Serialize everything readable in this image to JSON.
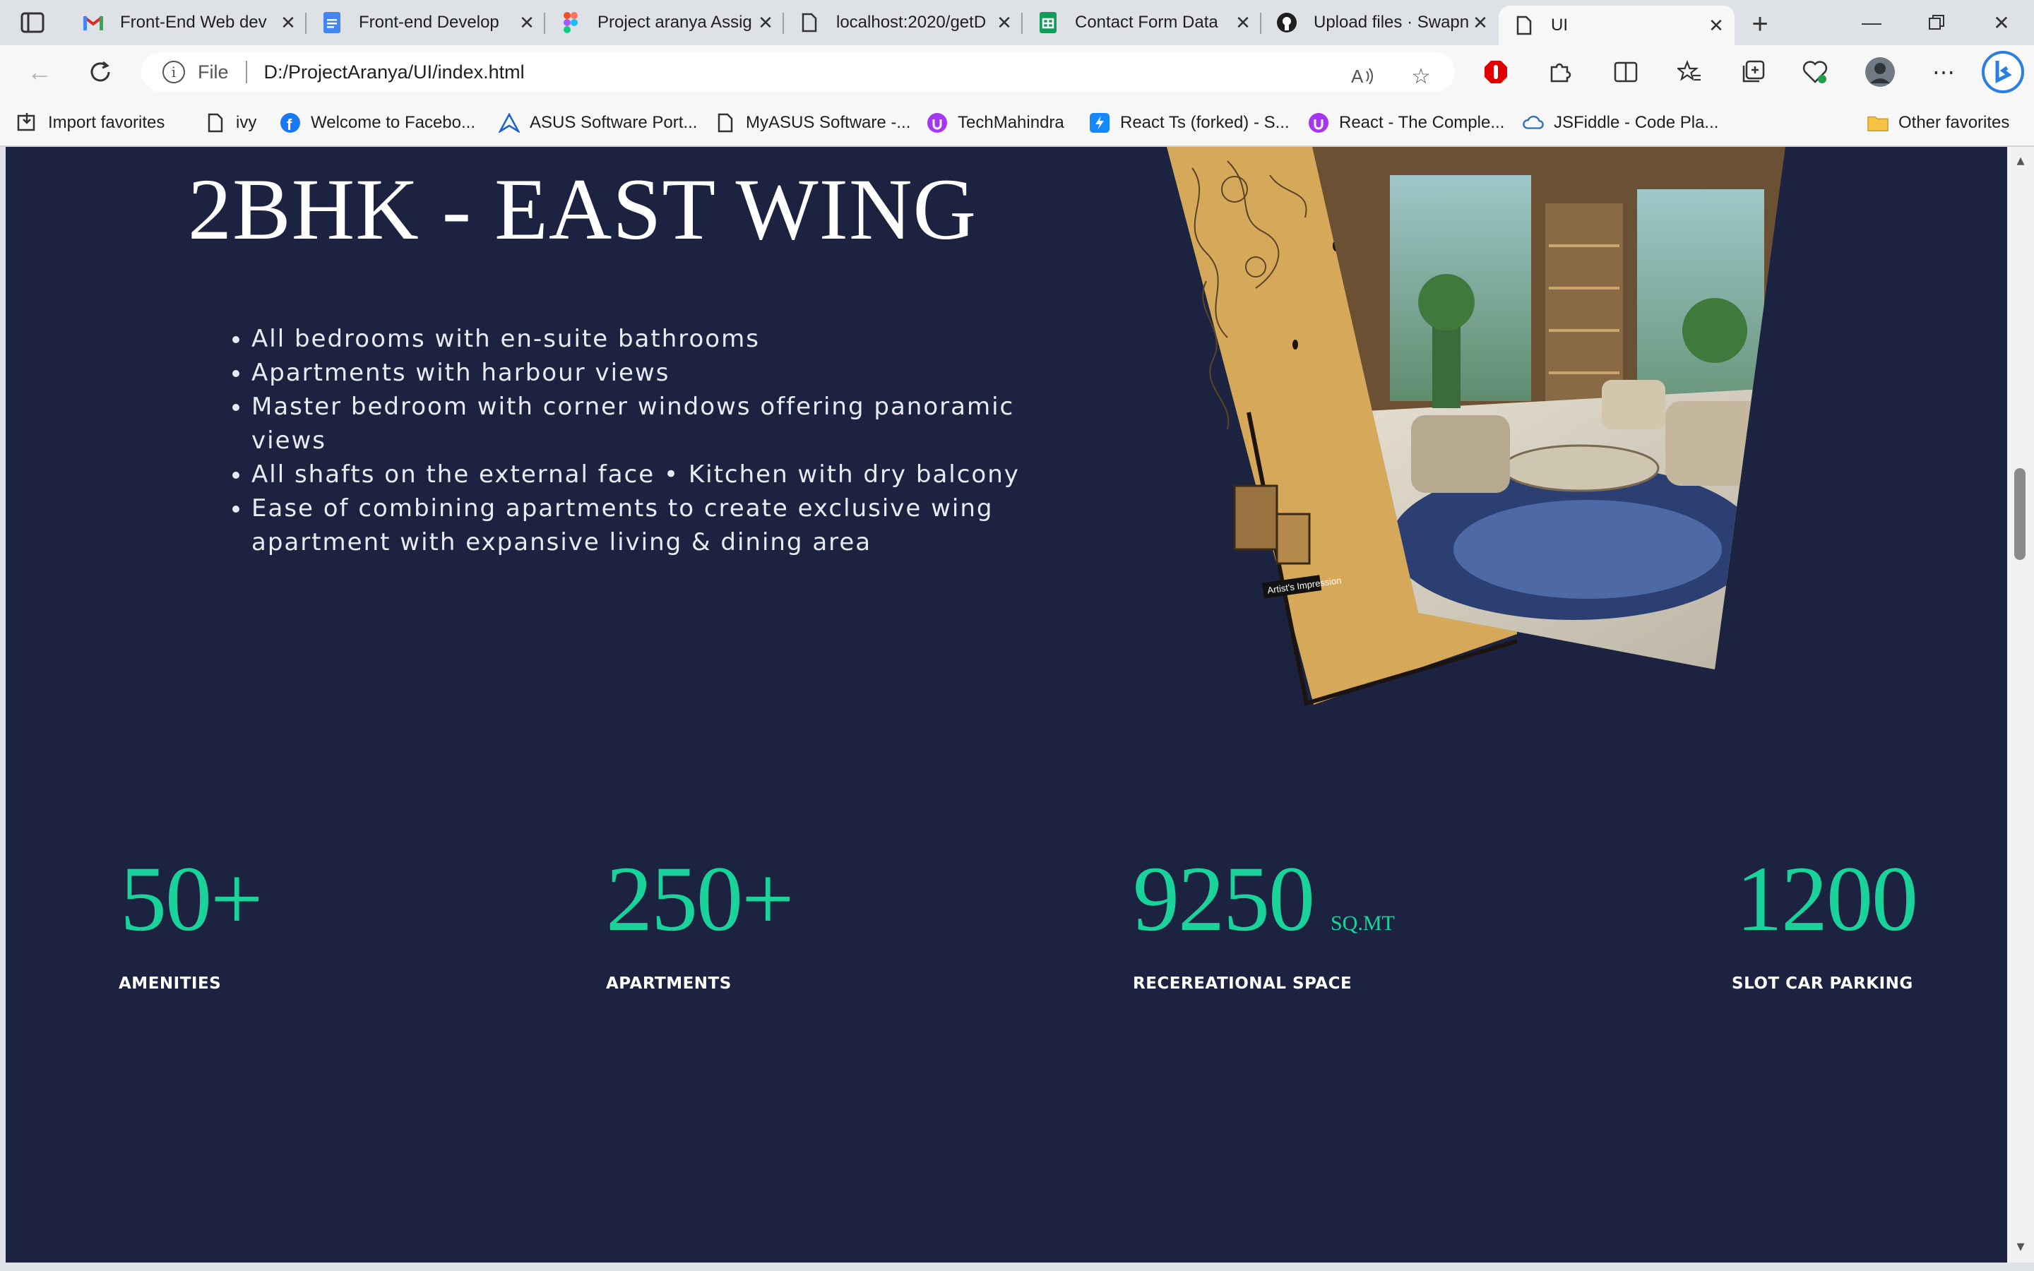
{
  "browser": {
    "tabs": [
      {
        "title": "Front-End Web dev",
        "icon": "gmail-icon"
      },
      {
        "title": "Front-end Develop",
        "icon": "google-docs-icon"
      },
      {
        "title": "Project aranya Assig",
        "icon": "figma-icon"
      },
      {
        "title": "localhost:2020/getD",
        "icon": "page-icon"
      },
      {
        "title": "Contact Form Data",
        "icon": "google-sheets-icon"
      },
      {
        "title": "Upload files · Swapn",
        "icon": "github-icon"
      },
      {
        "title": "UI",
        "icon": "page-icon",
        "active": true
      }
    ],
    "address": {
      "scheme_label": "File",
      "url": "D:/ProjectAranya/UI/index.html"
    },
    "favorites": [
      {
        "label": "Import favorites"
      },
      {
        "label": "ivy"
      },
      {
        "label": "Welcome to Facebo..."
      },
      {
        "label": "ASUS Software Port..."
      },
      {
        "label": "MyASUS Software -..."
      },
      {
        "label": "TechMahindra"
      },
      {
        "label": "React Ts (forked) - S..."
      },
      {
        "label": "React - The Comple..."
      },
      {
        "label": "JSFiddle - Code Pla..."
      }
    ],
    "other_favorites": "Other favorites"
  },
  "page": {
    "heading": "2BHK - EAST WING",
    "features": [
      "All bedrooms with en-suite bathrooms",
      "Apartments with harbour views",
      "Master bedroom with corner windows offering panoramic views",
      "All shafts on the external face • Kitchen with dry balcony",
      "Ease of combining apartments to create exclusive wing apartment with expansive living & dining area"
    ],
    "image_caption": "Artist's Impression",
    "stats": [
      {
        "value": "50+",
        "unit": "",
        "label": "AMENITIES"
      },
      {
        "value": "250+",
        "unit": "",
        "label": "APARTMENTS"
      },
      {
        "value": "9250",
        "unit": "SQ.MT",
        "label": "RECEREATIONAL SPACE"
      },
      {
        "value": "1200",
        "unit": "",
        "label": "SLOT CAR PARKING"
      }
    ]
  },
  "colors": {
    "page_background": "#1b2341",
    "accent": "#19d39b",
    "gold_panel": "#d6a85a"
  }
}
